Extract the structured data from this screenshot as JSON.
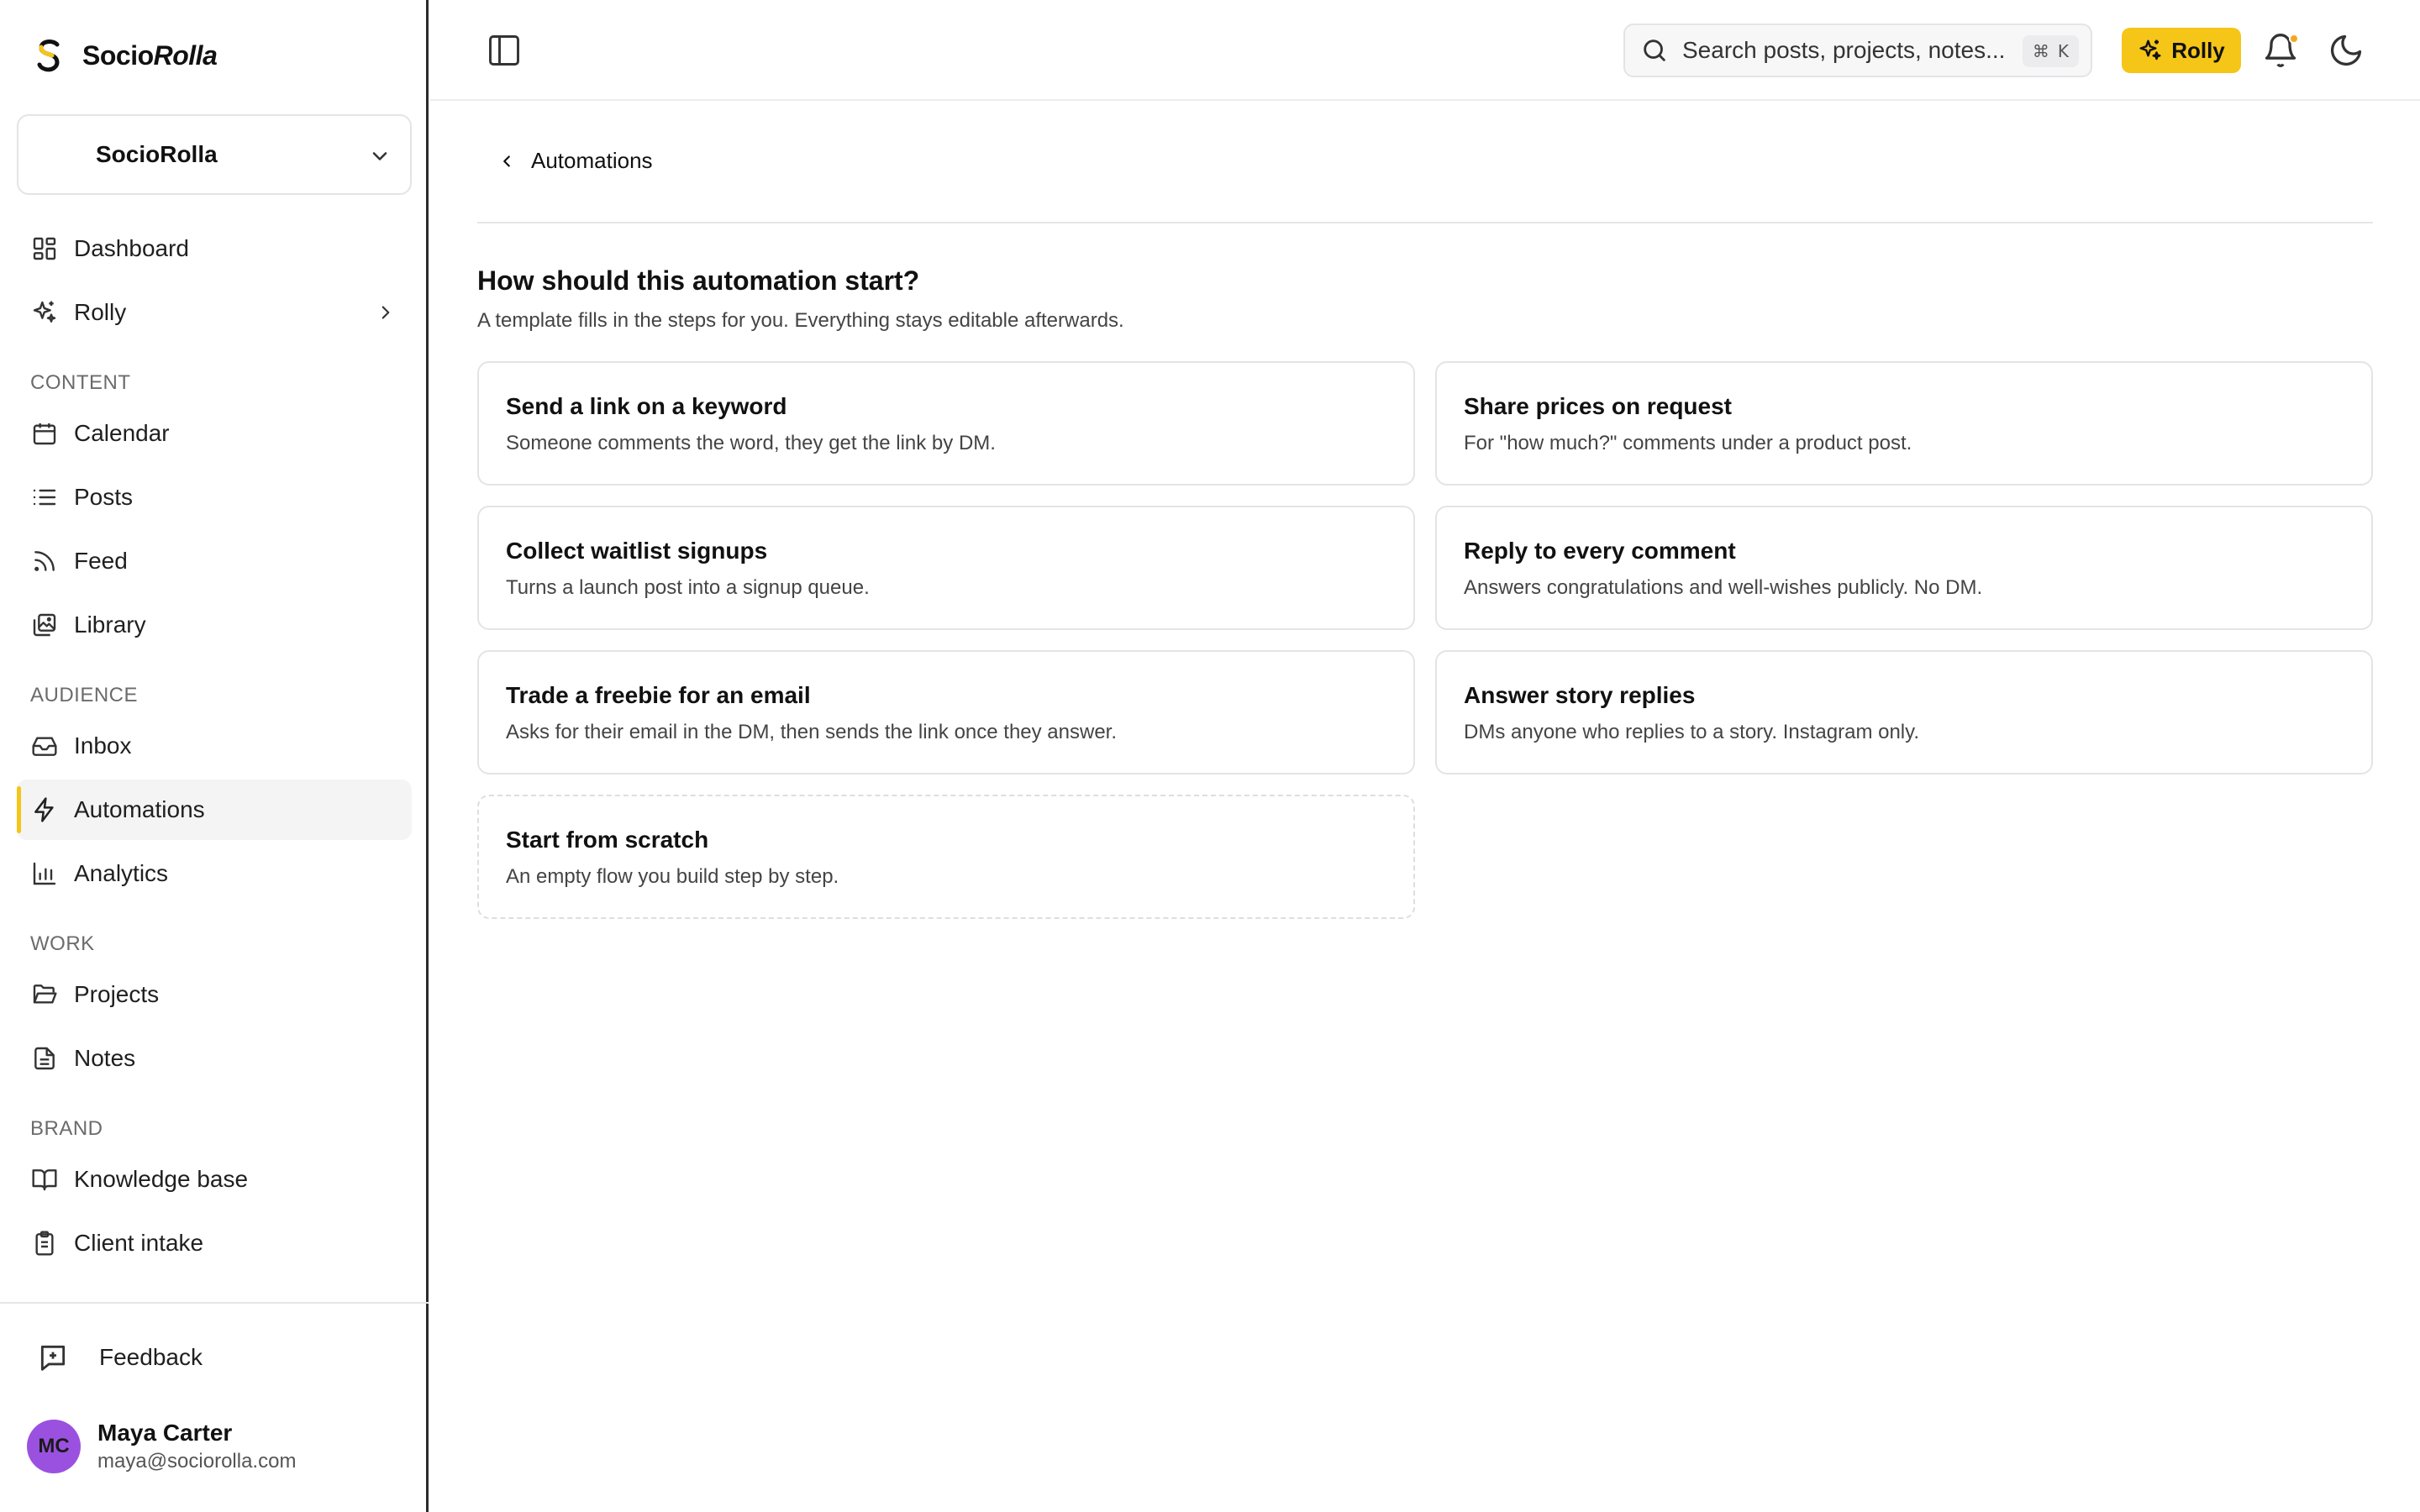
{
  "brand": {
    "name_part1": "Socio",
    "name_part2": "Rolla"
  },
  "workspace": {
    "name": "SocioRolla"
  },
  "nav": {
    "dashboard": "Dashboard",
    "rolly": "Rolly",
    "section_content": "CONTENT",
    "calendar": "Calendar",
    "posts": "Posts",
    "feed": "Feed",
    "library": "Library",
    "section_audience": "AUDIENCE",
    "inbox": "Inbox",
    "automations": "Automations",
    "analytics": "Analytics",
    "section_work": "WORK",
    "projects": "Projects",
    "notes": "Notes",
    "section_brand": "BRAND",
    "knowledge_base": "Knowledge base",
    "client_intake": "Client intake",
    "active": "Automations"
  },
  "feedback": {
    "label": "Feedback"
  },
  "user": {
    "initials": "MC",
    "name": "Maya Carter",
    "email": "maya@sociorolla.com"
  },
  "topbar": {
    "search_placeholder": "Search posts, projects, notes...",
    "shortcut_mod": "⌘",
    "shortcut_key": "K",
    "rolly_label": "Rolly",
    "has_notification": true
  },
  "page": {
    "back_label": "Automations",
    "title": "How should this automation start?",
    "subtitle": "A template fills in the steps for you. Everything stays editable afterwards."
  },
  "templates": [
    {
      "title": "Send a link on a keyword",
      "desc": "Someone comments the word, they get the link by DM."
    },
    {
      "title": "Share prices on request",
      "desc": "For \"how much?\" comments under a product post."
    },
    {
      "title": "Collect waitlist signups",
      "desc": "Turns a launch post into a signup queue."
    },
    {
      "title": "Reply to every comment",
      "desc": "Answers congratulations and well-wishes publicly. No DM."
    },
    {
      "title": "Trade a freebie for an email",
      "desc": "Asks for their email in the DM, then sends the link once they answer."
    },
    {
      "title": "Answer story replies",
      "desc": "DMs anyone who replies to a story. Instagram only."
    },
    {
      "title": "Start from scratch",
      "desc": "An empty flow you build step by step."
    }
  ],
  "colors": {
    "accent": "#f5c518",
    "avatar": "#9b51e0",
    "notification_dot": "#f5a623"
  }
}
